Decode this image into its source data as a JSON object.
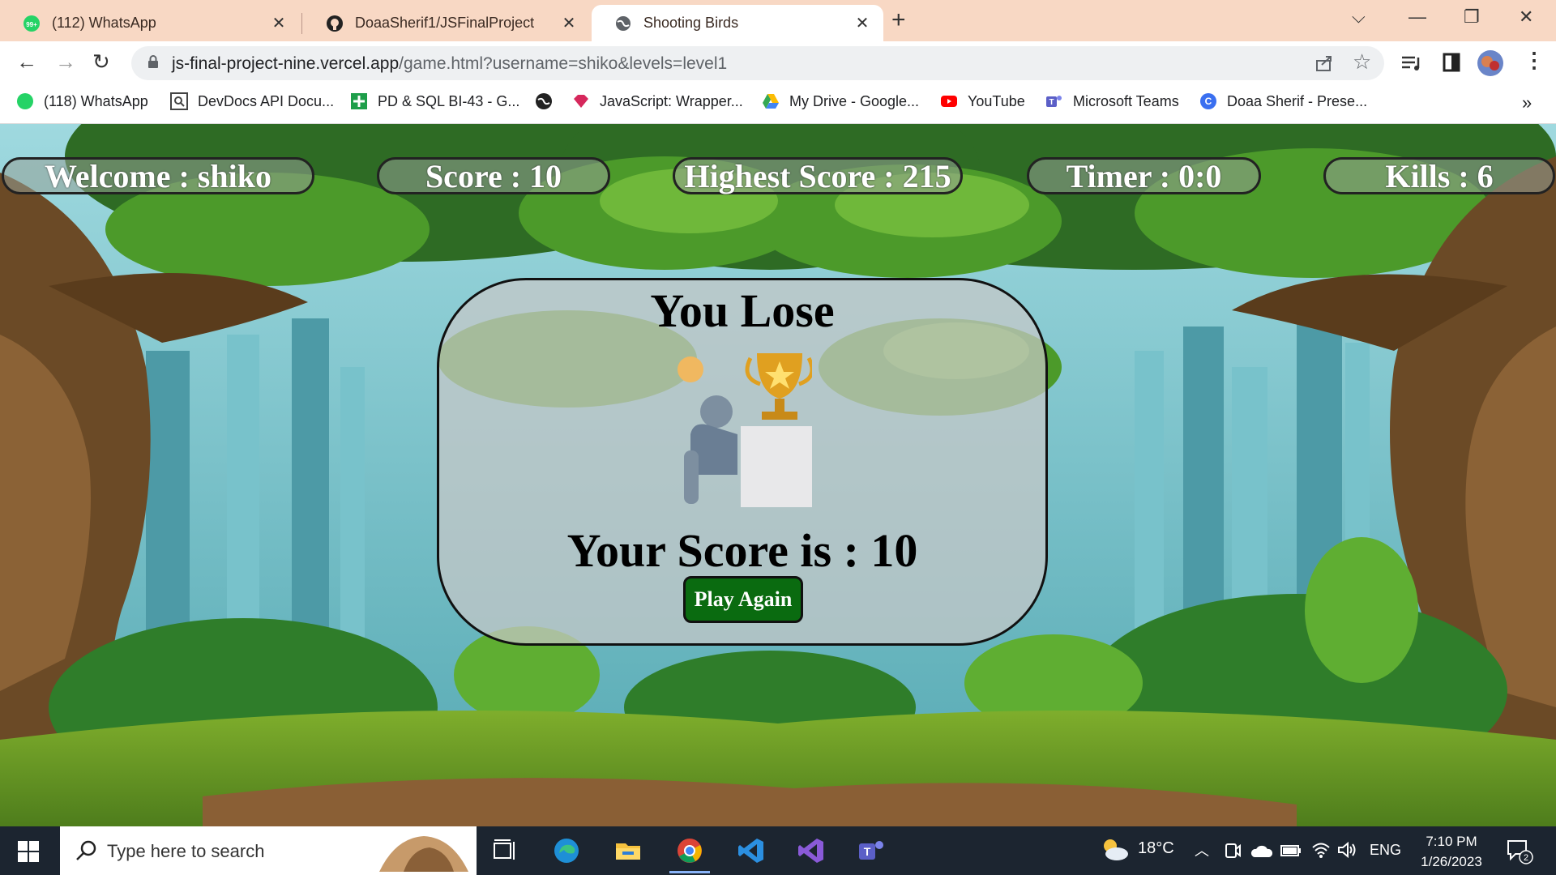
{
  "browser": {
    "tabs": [
      {
        "title": "(112) WhatsApp",
        "icon": "whatsapp-icon",
        "badge": "99+",
        "active": false
      },
      {
        "title": "DoaaSherif1/JSFinalProject",
        "icon": "github-icon",
        "active": false
      },
      {
        "title": "Shooting Birds",
        "icon": "globe-icon",
        "active": true
      }
    ],
    "url_host": "js-final-project-nine.vercel.app",
    "url_path": "/game.html?username=shiko&levels=level1",
    "bookmarks": [
      {
        "label": "(118) WhatsApp",
        "icon": "whatsapp-icon"
      },
      {
        "label": "DevDocs API Docu...",
        "icon": "devdocs-icon"
      },
      {
        "label": "PD & SQL BI-43 - G...",
        "icon": "green-plus-icon"
      },
      {
        "label": "",
        "icon": "globe-icon"
      },
      {
        "label": "JavaScript: Wrapper...",
        "icon": "gem-icon"
      },
      {
        "label": "My Drive - Google...",
        "icon": "google-drive-icon"
      },
      {
        "label": "YouTube",
        "icon": "youtube-icon"
      },
      {
        "label": "Microsoft Teams",
        "icon": "teams-icon"
      },
      {
        "label": "Doaa Sherif - Prese...",
        "icon": "canva-icon"
      }
    ],
    "more_bookmarks": "»",
    "accent": "#f8d8c4"
  },
  "game": {
    "hud": {
      "welcome": "Welcome : shiko",
      "score": "Score : 10",
      "highest": "Highest Score : 215",
      "timer": "Timer : 0:0",
      "kills": "Kills : 6"
    },
    "panel": {
      "title": "You Lose",
      "score_text": "Your Score is : 10",
      "play_again": "Play Again"
    },
    "button_color": "#0a6b10"
  },
  "taskbar": {
    "search_placeholder": "Type here to search",
    "weather": "18°C",
    "language": "ENG",
    "time": "7:10 PM",
    "date": "1/26/2023",
    "notification_count": "2"
  }
}
